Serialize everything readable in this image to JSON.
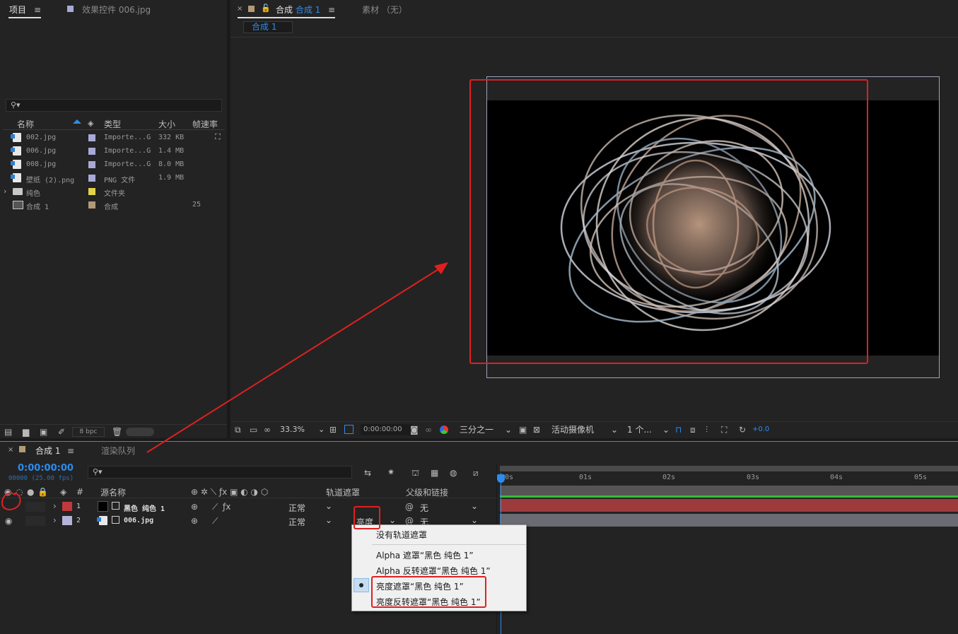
{
  "project_panel": {
    "tab_label": "项目",
    "effects_tab_label": "效果控件 006.jpg",
    "search_placeholder": "",
    "columns": {
      "name": "名称",
      "type": "类型",
      "size": "大小",
      "framerate": "帧速率"
    },
    "items": [
      {
        "name": "002.jpg",
        "type": "Importe...G",
        "size": "332 KB",
        "fps": "",
        "color": "#a9a9d8"
      },
      {
        "name": "006.jpg",
        "type": "Importe...G",
        "size": "1.4 MB",
        "fps": "",
        "color": "#a9a9d8"
      },
      {
        "name": "008.jpg",
        "type": "Importe...G",
        "size": "8.0 MB",
        "fps": "",
        "color": "#a9a9d8"
      },
      {
        "name": "壁纸 (2).png",
        "type": "PNG 文件",
        "size": "1.9 MB",
        "fps": "",
        "color": "#a9a9d8"
      },
      {
        "name": "纯色",
        "type": "文件夹",
        "size": "",
        "fps": "",
        "color": "#e3d34b"
      },
      {
        "name": "合成 1",
        "type": "合成",
        "size": "",
        "fps": "25",
        "color": "#b39a77"
      }
    ],
    "bpc_label": "8 bpc"
  },
  "comp_panel": {
    "tab_prefix": "合成",
    "tab_name": "合成 1",
    "footage_tab": "素材 （无）",
    "breadcrumb": "合成 1",
    "toolbar": {
      "zoom": "33.3%",
      "timecode": "0:00:00:00",
      "grid": "三分之一",
      "camera": "活动摄像机",
      "views": "1 个...",
      "exposure": "+0.0"
    }
  },
  "timeline": {
    "tab_label": "合成 1",
    "render_queue_label": "渲染队列",
    "timecode": "0:00:00:00",
    "frame_info": "00000 (25.00 fps)",
    "columns": {
      "number": "#",
      "source_name": "源名称",
      "track_matte": "轨道遮罩",
      "parent": "父级和链接"
    },
    "layers": [
      {
        "num": "1",
        "name": "黑色 纯色 1",
        "mode": "正常",
        "matte": "",
        "parent": "无",
        "color": "#c0393b"
      },
      {
        "num": "2",
        "name": "006.jpg",
        "mode": "正常",
        "matte": "亮度",
        "parent": "无",
        "color": "#b3b3da"
      }
    ],
    "ruler": [
      "0s",
      "01s",
      "02s",
      "03s",
      "04s",
      "05s"
    ]
  },
  "matte_menu": {
    "items": [
      "没有轨道遮罩",
      "Alpha 遮罩“黑色 纯色 1”",
      "Alpha 反转遮罩“黑色 纯色 1”",
      "亮度遮罩“黑色 纯色 1”",
      "亮度反转遮罩“黑色 纯色 1”"
    ],
    "selected_index": 3
  },
  "colors": {
    "accent": "#2d8ceb",
    "annotation_red": "#e02020",
    "layer1_bar": "#9c3b3c",
    "layer2_bar": "#6b6b73"
  }
}
